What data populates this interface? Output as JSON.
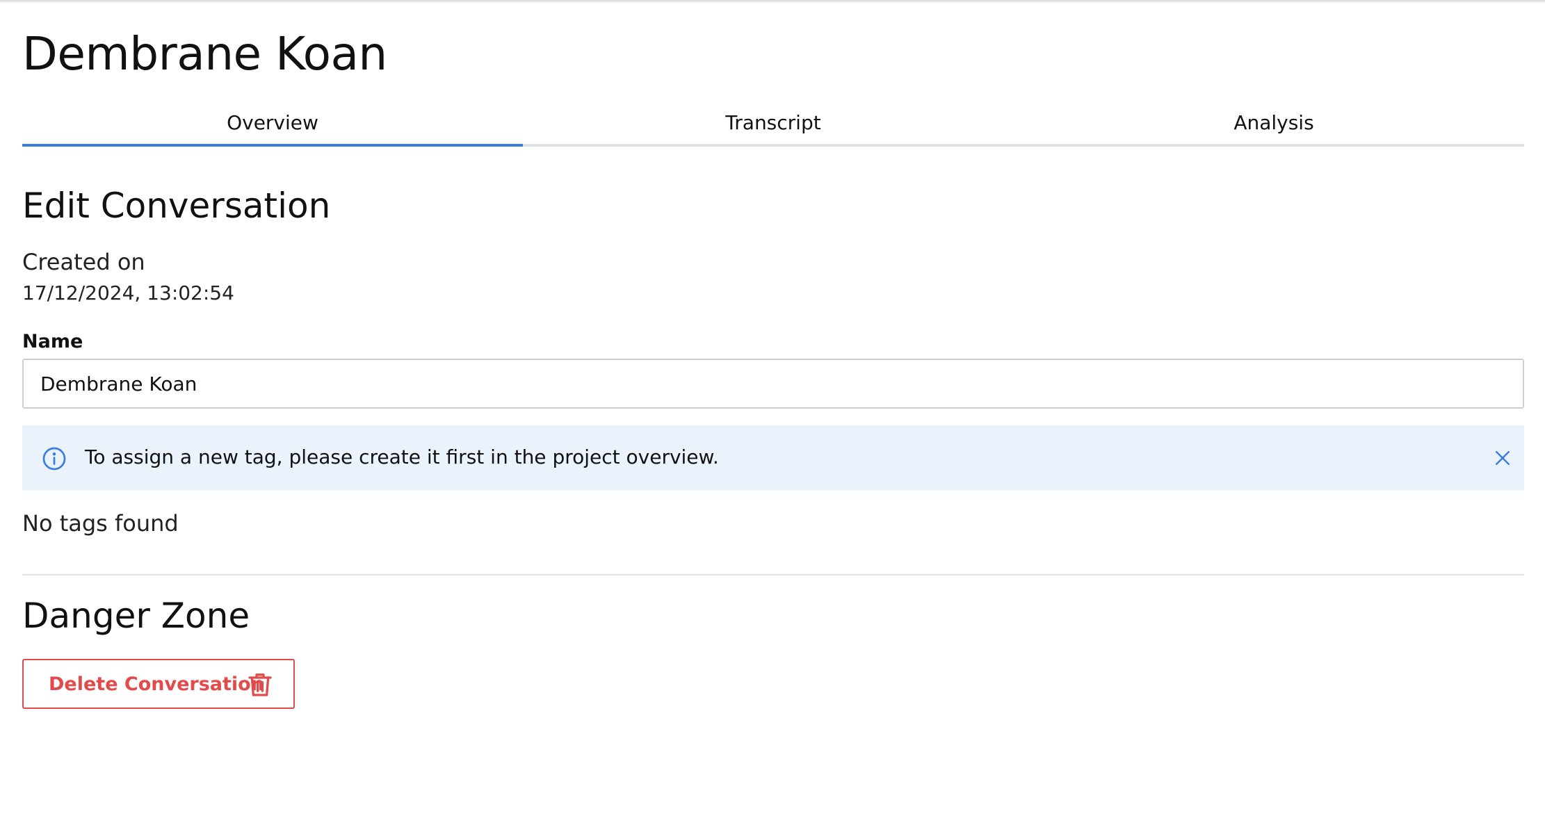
{
  "page": {
    "title": "Dembrane Koan"
  },
  "tabs": [
    {
      "label": "Overview",
      "active": true
    },
    {
      "label": "Transcript",
      "active": false
    },
    {
      "label": "Analysis",
      "active": false
    }
  ],
  "edit_section": {
    "title": "Edit Conversation",
    "created_label": "Created on",
    "created_value": "17/12/2024, 13:02:54",
    "name_label": "Name",
    "name_value": "Dembrane Koan",
    "alert": {
      "icon": "info-icon",
      "text": "To assign a new tag, please create it first in the project overview.",
      "close_icon": "close-icon",
      "background": "#eaf2fc",
      "accent": "#3b7ddd"
    },
    "tags_empty_text": "No tags found"
  },
  "danger_section": {
    "title": "Danger Zone",
    "delete_label": "Delete Conversation",
    "delete_icon": "trash-icon",
    "danger_color": "#e24b4b"
  },
  "colors": {
    "active_tab": "#3b7ddd",
    "tab_border": "#dee2e6"
  }
}
